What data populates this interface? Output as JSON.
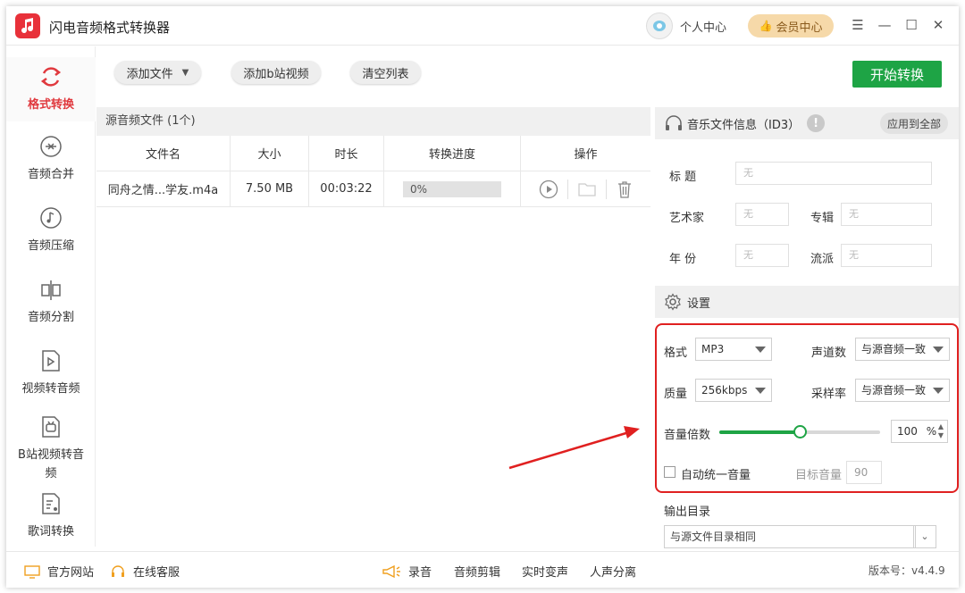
{
  "app": {
    "title": "闪电音频格式转换器",
    "personal_center": "个人中心",
    "vip_center": "会员中心"
  },
  "sidebar": {
    "items": [
      {
        "label": "格式转换"
      },
      {
        "label": "音频合并"
      },
      {
        "label": "音频压缩"
      },
      {
        "label": "音频分割"
      },
      {
        "label": "视频转音频"
      },
      {
        "label": "B站视频转音",
        "label2": "频"
      },
      {
        "label": "歌词转换"
      }
    ]
  },
  "toolbar": {
    "add_file": "添加文件",
    "add_bili": "添加b站视频",
    "clear_list": "清空列表",
    "start": "开始转换"
  },
  "files": {
    "header": "源音频文件 (1个)",
    "columns": [
      "文件名",
      "大小",
      "时长",
      "转换进度",
      "操作"
    ],
    "rows": [
      {
        "name": "同舟之情...学友.m4a",
        "size": "7.50 MB",
        "duration": "00:03:22",
        "progress": "0%",
        "progress_value": 0
      }
    ]
  },
  "id3": {
    "header": "音乐文件信息（ID3）",
    "apply_all": "应用到全部",
    "title_label": "标  题",
    "title_value": "无",
    "artist_label": "艺术家",
    "artist_value": "无",
    "album_label": "专辑",
    "album_value": "无",
    "year_label": "年  份",
    "year_value": "无",
    "genre_label": "流派",
    "genre_value": "无"
  },
  "settings": {
    "header": "设置",
    "format_label": "格式",
    "format_value": "MP3",
    "channels_label": "声道数",
    "channels_value": "与源音频一致",
    "quality_label": "质量",
    "quality_value": "256kbps",
    "samplerate_label": "采样率",
    "samplerate_value": "与源音频一致",
    "volume_label": "音量倍数",
    "volume_value": "100",
    "volume_unit": "%",
    "volume_fraction": 0.5,
    "auto_volume_label": "自动统一音量",
    "target_volume_label": "目标音量",
    "target_volume_value": "90"
  },
  "output": {
    "label": "输出目录",
    "value": "与源文件目录相同"
  },
  "bottom": {
    "website": "官方网站",
    "support": "在线客服",
    "record": "录音",
    "edit": "音频剪辑",
    "voice_change": "实时变声",
    "separation": "人声分离",
    "version": "版本号：v4.4.9"
  },
  "colors": {
    "accent_red": "#e0393e",
    "green": "#1ea445",
    "highlight": "#e02020"
  }
}
